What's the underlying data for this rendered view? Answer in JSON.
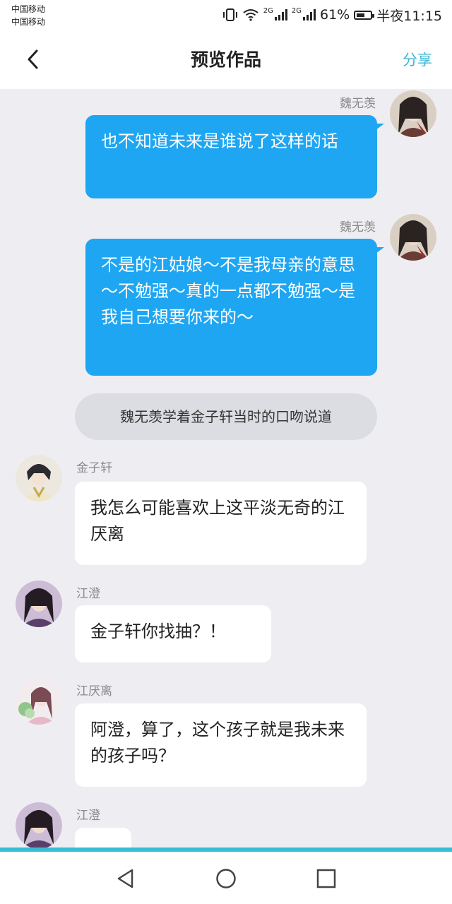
{
  "status_bar": {
    "carrier_1": "中国移动",
    "carrier_2": "中国移动",
    "net_1": "2G",
    "net_2": "2G",
    "battery_percent": "61%",
    "battery_level": 0.61,
    "time": "半夜11:15"
  },
  "header": {
    "back_icon": "chevron-left-icon",
    "title": "预览作品",
    "share_label": "分享",
    "accent_color": "#3ab6d4"
  },
  "messages": [
    {
      "side": "right",
      "name": "魏无羡",
      "text": "也不知道未来是谁说了这样的话"
    },
    {
      "side": "right",
      "name": "魏无羡",
      "text": "不是的江姑娘～不是我母亲的意思～不勉强～真的一点都不勉强～是我自己想要你来的～"
    },
    {
      "side": "center",
      "text": "魏无羡学着金子轩当时的口吻说道"
    },
    {
      "side": "left",
      "name": "金子轩",
      "text": "我怎么可能喜欢上这平淡无奇的江厌离"
    },
    {
      "side": "left",
      "name": "江澄",
      "text": "金子轩你找抽？！"
    },
    {
      "side": "left",
      "name": "江厌离",
      "text": "阿澄，算了，这个孩子就是我未来的孩子吗？"
    },
    {
      "side": "left",
      "name": "江澄",
      "text": ""
    }
  ],
  "bubble_colors": {
    "right": "#1ea6f2",
    "left": "#ffffff",
    "narration": "#dcdde3"
  },
  "nav": {
    "back_icon": "triangle-back-icon",
    "home_icon": "circle-home-icon",
    "recents_icon": "square-recents-icon"
  }
}
